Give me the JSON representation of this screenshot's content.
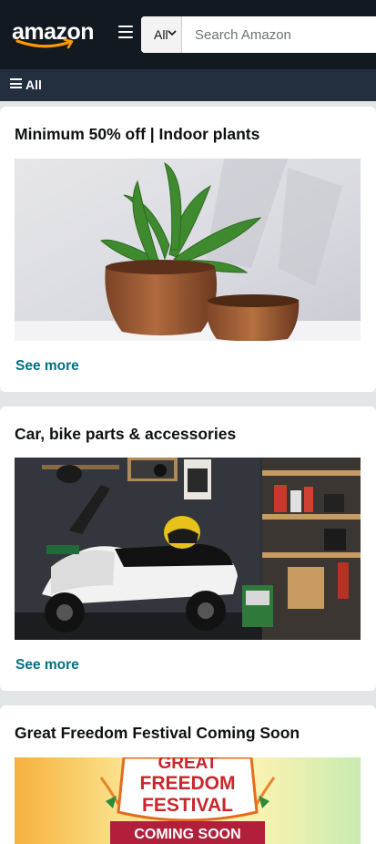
{
  "header": {
    "logo_text": "amazon",
    "menu_icon": "hamburger-menu-icon",
    "search_category": "All",
    "search_placeholder": "Search Amazon"
  },
  "subnav": {
    "all_label": "All"
  },
  "cards": [
    {
      "title": "Minimum 50% off | Indoor plants",
      "see_more": "See more"
    },
    {
      "title": "Car, bike parts & accessories",
      "see_more": "See more"
    },
    {
      "title": "Great Freedom Festival Coming Soon",
      "banner": {
        "line1": "GREAT",
        "line2": "FREEDOM",
        "line3": "FESTIVAL",
        "line4": "COMING SOON"
      }
    }
  ],
  "colors": {
    "header_bg": "#131921",
    "subnav_bg": "#232f3e",
    "link": "#007185",
    "logo_smile": "#ff9900"
  }
}
